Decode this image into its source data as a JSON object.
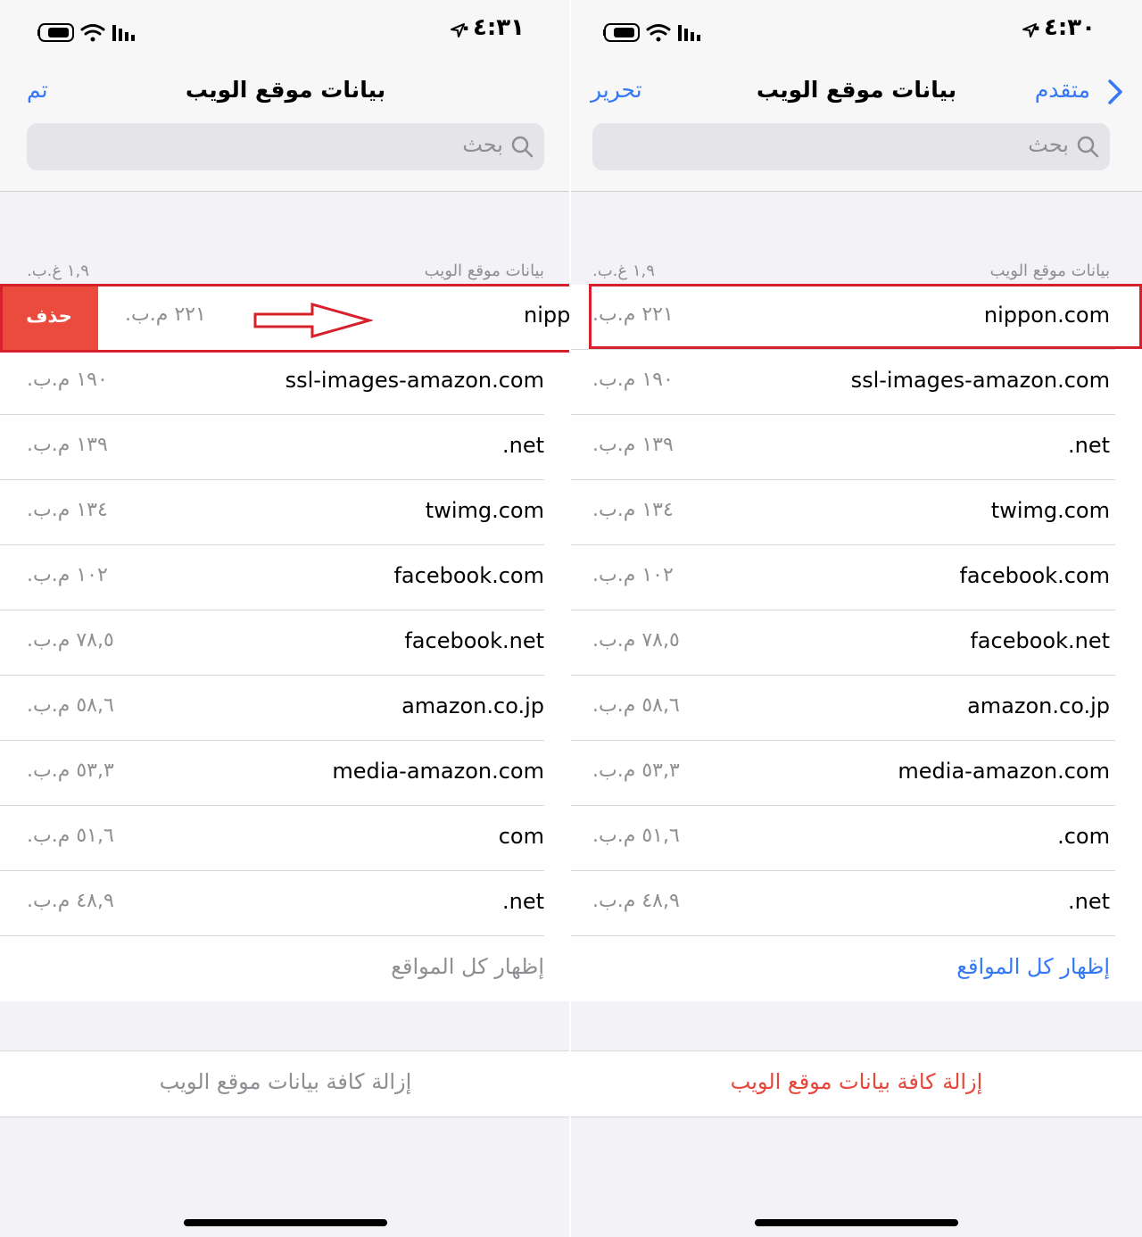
{
  "left_screen": {
    "status": {
      "time": "٠٤:٣١"
    },
    "nav": {
      "title": "بيانات موقع الويب",
      "done": "تم"
    },
    "search": {
      "placeholder": "بحث"
    },
    "section": {
      "title": "بيانات موقع الويب",
      "total": "١,٩ غ.ب."
    },
    "swipe_row": {
      "site": "nippon.com",
      "size": "٢٢١ م.ب.",
      "delete_label": "حذف"
    },
    "rows": [
      {
        "site": "ssl-images-amazon.com",
        "size": "١٩٠ م.ب."
      },
      {
        "site": ".net",
        "size": "١٣٩ م.ب."
      },
      {
        "site": "twimg.com",
        "size": "١٣٤ م.ب."
      },
      {
        "site": "facebook.com",
        "size": "١٠٢ م.ب."
      },
      {
        "site": "facebook.net",
        "size": "٧٨,٥ م.ب."
      },
      {
        "site": "amazon.co.jp",
        "size": "٥٨,٦ م.ب."
      },
      {
        "site": "media-amazon.com",
        "size": "٥٣,٣ م.ب."
      },
      {
        "site": "com",
        "size": "٥١,٦ م.ب."
      },
      {
        "site": ".net",
        "size": "٤٨,٩ م.ب."
      }
    ],
    "show_all": "إظهار كل المواقع",
    "remove_all": "إزالة كافة بيانات موقع الويب"
  },
  "right_screen": {
    "status": {
      "time": "٠٤:٣٠"
    },
    "nav": {
      "title": "بيانات موقع الويب",
      "back": "متقدم",
      "edit": "تحرير"
    },
    "search": {
      "placeholder": "بحث"
    },
    "section": {
      "title": "بيانات موقع الويب",
      "total": "١,٩ غ.ب."
    },
    "rows": [
      {
        "site": "nippon.com",
        "size": "٢٢١ م.ب."
      },
      {
        "site": "ssl-images-amazon.com",
        "size": "١٩٠ م.ب."
      },
      {
        "site": ".net",
        "size": "١٣٩ م.ب."
      },
      {
        "site": "twimg.com",
        "size": "١٣٤ م.ب."
      },
      {
        "site": "facebook.com",
        "size": "١٠٢ م.ب."
      },
      {
        "site": "facebook.net",
        "size": "٧٨,٥ م.ب."
      },
      {
        "site": "amazon.co.jp",
        "size": "٥٨,٦ م.ب."
      },
      {
        "site": "media-amazon.com",
        "size": "٥٣,٣ م.ب."
      },
      {
        "site": ".com",
        "size": "٥١,٦ م.ب."
      },
      {
        "site": ".net",
        "size": "٤٨,٩ م.ب."
      }
    ],
    "show_all": "إظهار كل المواقع",
    "remove_all": "إزالة كافة بيانات موقع الويب"
  },
  "colors": {
    "accent": "#3478f6",
    "destructive": "#e5473a",
    "disabled": "#8e8e93",
    "annotation": "#d6202b"
  },
  "icons": [
    "location-arrow-icon",
    "battery-icon",
    "wifi-icon",
    "signal-icon",
    "search-icon",
    "chevron-right-icon",
    "arrow-right-annotation"
  ]
}
